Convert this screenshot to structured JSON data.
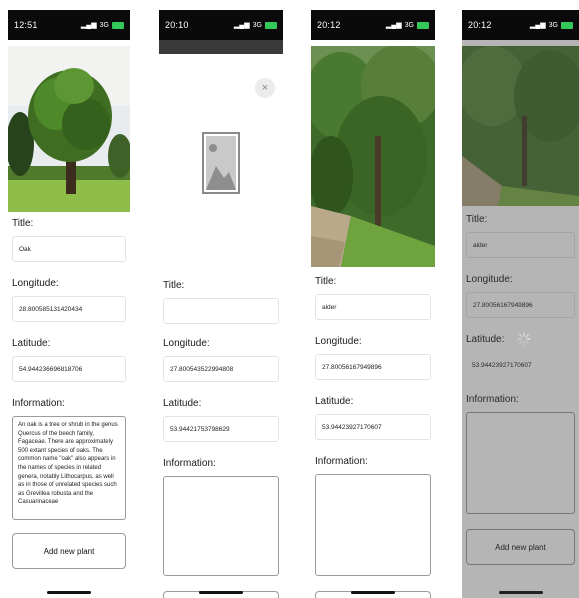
{
  "screens": [
    {
      "status": {
        "time": "12:51",
        "network": "3G"
      },
      "form": {
        "title_label": "Title:",
        "title_value": "Oak",
        "longitude_label": "Longitude:",
        "longitude_value": "28.800585131420434",
        "latitude_label": "Latitude:",
        "latitude_value": "54.944236696818706",
        "information_label": "Information:",
        "information_value": "An oak is a tree or shrub in the genus Quercus of the beech family, Fagaceae. There are approximately 500 extant species of oaks. The common name \"oak\" also appears in the names of species in related genera, notably Lithocarpus, as well as in those of unrelated species such as Grevillea robusta and the Casuarinaceae"
      },
      "add_button": "Add new plant"
    },
    {
      "status": {
        "time": "20:10",
        "network": "3G"
      },
      "form": {
        "title_label": "Title:",
        "title_value": "",
        "longitude_label": "Longitude:",
        "longitude_value": "27.800543522994808",
        "latitude_label": "Latitude:",
        "latitude_value": "53.94421753798629",
        "information_label": "Information:",
        "information_value": ""
      },
      "close_icon": "×"
    },
    {
      "status": {
        "time": "20:12",
        "network": "3G"
      },
      "form": {
        "title_label": "Title:",
        "title_value": "alder",
        "longitude_label": "Longitude:",
        "longitude_value": "27.80056167949896",
        "latitude_label": "Latitude:",
        "latitude_value": "53.94423927170607",
        "information_label": "Information:",
        "information_value": ""
      }
    },
    {
      "status": {
        "time": "20:12",
        "network": "3G"
      },
      "form": {
        "title_label": "Title:",
        "title_value": "alder",
        "longitude_label": "Longitude:",
        "longitude_value": "27.80056167949896",
        "latitude_label": "Latitude:",
        "latitude_value": "53.94423927170607",
        "information_label": "Information:",
        "information_value": ""
      },
      "add_button": "Add new plant",
      "loading": true
    }
  ],
  "icons": {
    "close": "close-icon",
    "placeholder": "image-placeholder-icon",
    "spinner": "loading-spinner-icon"
  },
  "colors": {
    "status_bar": "#0a0a0a",
    "battery": "#34c759",
    "field_border": "#e4e4e4",
    "overlay": "#5a5a5a"
  }
}
